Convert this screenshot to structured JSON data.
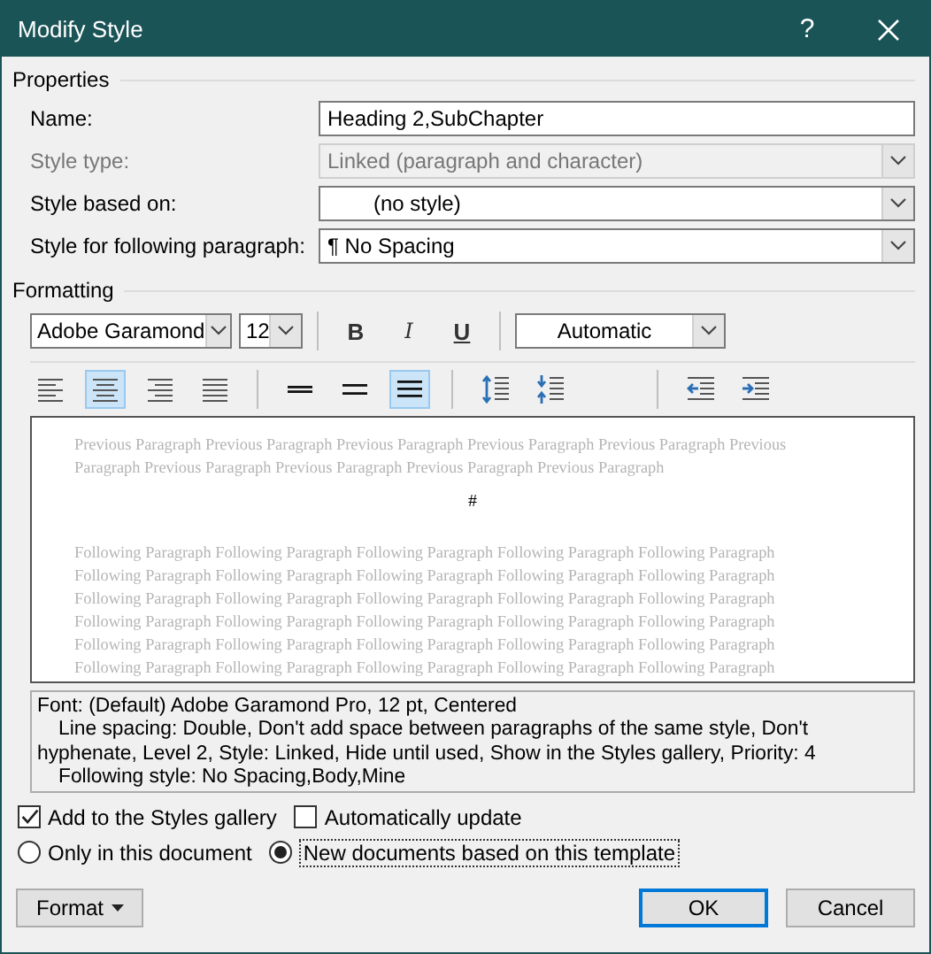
{
  "window": {
    "title": "Modify Style",
    "help": "?"
  },
  "properties": {
    "heading": "Properties",
    "fields": [
      {
        "label": "Name:",
        "kind": "text",
        "value": "Heading 2,SubChapter",
        "disabled": false
      },
      {
        "label": "Style type:",
        "kind": "dropdown",
        "value": "Linked (paragraph and character)",
        "disabled": true
      },
      {
        "label": "Style based on:",
        "kind": "dropdown",
        "value": "(no style)",
        "disabled": false
      },
      {
        "label": "Style for following paragraph:",
        "kind": "dropdown",
        "value": "¶  No Spacing",
        "disabled": false
      }
    ]
  },
  "formatting": {
    "heading": "Formatting",
    "font": "Adobe Garamond",
    "size": "12",
    "styles": [
      {
        "kind": "bold",
        "label": "B"
      },
      {
        "kind": "italic",
        "label": "I"
      },
      {
        "kind": "underline",
        "label": "U"
      }
    ],
    "font_color": "Automatic",
    "tools": [
      {
        "kind": "align-left",
        "selected": false
      },
      {
        "kind": "align-center",
        "selected": true
      },
      {
        "kind": "align-right",
        "selected": false
      },
      {
        "kind": "justify",
        "selected": false
      },
      {
        "kind": "sep"
      },
      {
        "kind": "single",
        "selected": false
      },
      {
        "kind": "one-half",
        "selected": false
      },
      {
        "kind": "double",
        "selected": true
      },
      {
        "kind": "sep"
      },
      {
        "kind": "space-increase",
        "selected": false
      },
      {
        "kind": "space-decrease",
        "selected": false
      },
      {
        "kind": "gap"
      },
      {
        "kind": "sep"
      },
      {
        "kind": "indent-decrease",
        "selected": false
      },
      {
        "kind": "indent-increase",
        "selected": false
      }
    ]
  },
  "preview": {
    "previous": [
      "Previous Paragraph Previous Paragraph Previous Paragraph Previous Paragraph Previous Paragraph Previous",
      "Paragraph Previous Paragraph Previous Paragraph Previous Paragraph Previous Paragraph"
    ],
    "sample": "#",
    "following": [
      "Following Paragraph Following Paragraph Following Paragraph Following Paragraph Following Paragraph",
      "Following Paragraph Following Paragraph Following Paragraph Following Paragraph Following Paragraph",
      "Following Paragraph Following Paragraph Following Paragraph Following Paragraph Following Paragraph",
      "Following Paragraph Following Paragraph Following Paragraph Following Paragraph Following Paragraph",
      "Following Paragraph Following Paragraph Following Paragraph Following Paragraph Following Paragraph",
      "Following Paragraph Following Paragraph Following Paragraph Following Paragraph Following Paragraph"
    ]
  },
  "description": [
    {
      "text": "Font: (Default) Adobe Garamond Pro, 12 pt, Centered",
      "indent": false
    },
    {
      "text": "Line spacing:  Double, Don't add space between paragraphs of the same style, Don't",
      "indent": true
    },
    {
      "text": "hyphenate, Level 2, Style: Linked, Hide until used, Show in the Styles gallery, Priority: 4",
      "indent": false
    },
    {
      "text": "Following style: No Spacing,Body,Mine",
      "indent": true
    }
  ],
  "checkboxes": [
    {
      "label": "Add to the Styles gallery",
      "checked": true
    },
    {
      "label": "Automatically update",
      "checked": false
    }
  ],
  "radios": [
    {
      "label": "Only in this document",
      "selected": false
    },
    {
      "label": "New documents based on this template",
      "selected": true
    }
  ],
  "buttons": {
    "format": "Format",
    "ok": "OK",
    "cancel": "Cancel"
  }
}
